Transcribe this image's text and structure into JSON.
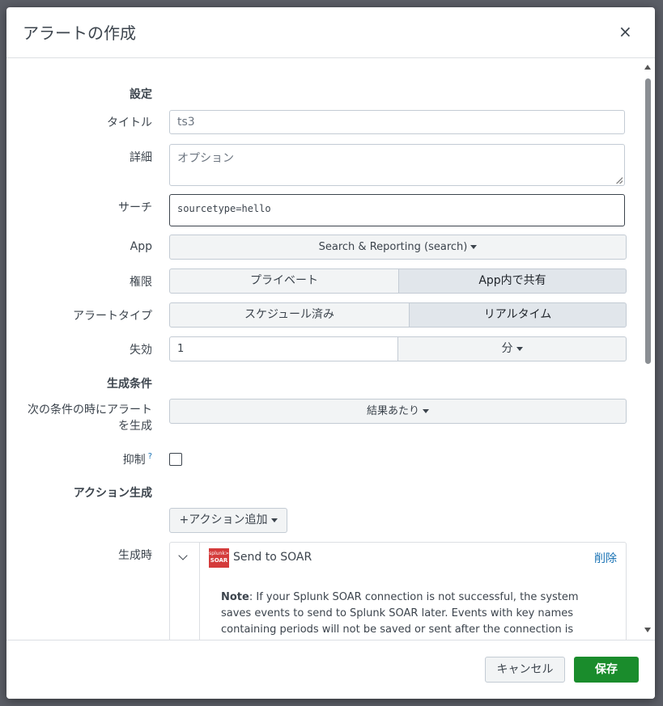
{
  "dialog": {
    "title": "アラートの作成",
    "close_icon": "×"
  },
  "sections": {
    "settings": "設定",
    "trigger_conditions": "生成条件",
    "trigger_actions": "アクション生成"
  },
  "fields": {
    "title": {
      "label": "タイトル",
      "value": "ts3"
    },
    "description": {
      "label": "詳細",
      "placeholder": "オプション"
    },
    "search": {
      "label": "サーチ",
      "value": "sourcetype=hello"
    },
    "app": {
      "label": "App",
      "value": "Search & Reporting (search)"
    },
    "permissions": {
      "label": "権限",
      "options": [
        "プライベート",
        "App内で共有"
      ],
      "selected": "App内で共有"
    },
    "alert_type": {
      "label": "アラートタイプ",
      "options": [
        "スケジュール済み",
        "リアルタイム"
      ],
      "selected": "リアルタイム"
    },
    "expires": {
      "label": "失効",
      "value": "1",
      "unit": "分"
    },
    "trigger_alert_when": {
      "label_line1": "次の条件の時にアラート",
      "label_line2": "を生成",
      "value": "結果あたり"
    },
    "throttle": {
      "label": "抑制",
      "help": "?",
      "checked": false
    },
    "add_actions": {
      "label": "+アクション追加"
    },
    "when_triggered": {
      "label": "生成時"
    }
  },
  "action": {
    "name": "Send to SOAR",
    "logo_line1": "splunk>",
    "logo_line2": "SOAR",
    "delete_label": "削除",
    "note_bold": "Note",
    "note_text": ": If your Splunk SOAR connection is not successful, the system saves events to send to Splunk SOAR later. Events with key names containing periods will not be saved or sent after the connection is reestablished."
  },
  "footer": {
    "cancel_label": "キャンセル",
    "save_label": "保存"
  },
  "colors": {
    "save_button": "#1a8c2c",
    "link": "#1a73b5",
    "soar_logo": "#d43b3b"
  }
}
